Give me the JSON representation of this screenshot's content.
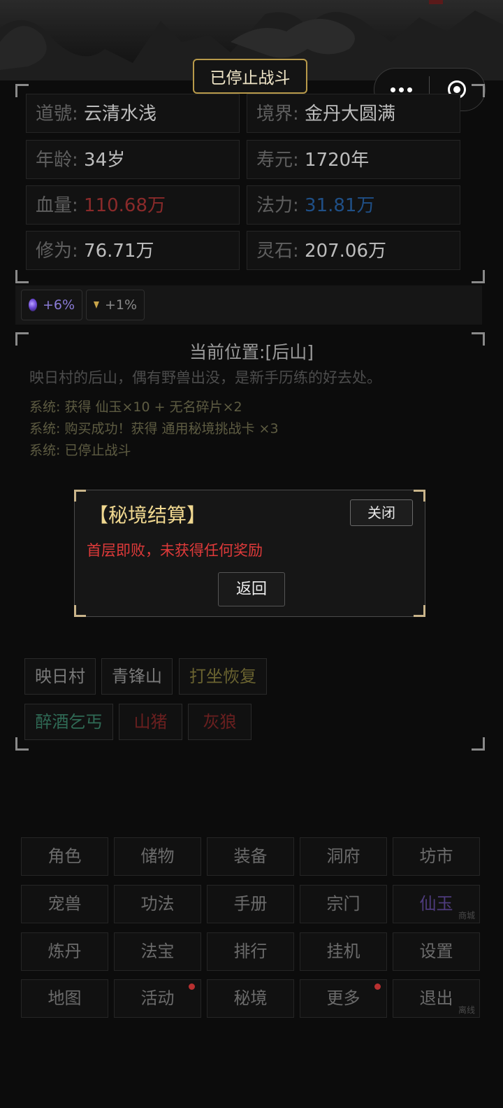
{
  "header": {
    "battle_status": "已停止战斗"
  },
  "stats": [
    {
      "label": "道號:",
      "value": "云清水浅"
    },
    {
      "label": "境界:",
      "value": "金丹大圆满"
    },
    {
      "label": "年龄:",
      "value": "34岁"
    },
    {
      "label": "寿元:",
      "value": "1720年"
    },
    {
      "label": "血量:",
      "value": "110.68万",
      "color": "#8a2a2a"
    },
    {
      "label": "法力:",
      "value": "31.81万",
      "color": "#1f4f86"
    },
    {
      "label": "修为:",
      "value": "76.71万"
    },
    {
      "label": "灵石:",
      "value": "207.06万"
    }
  ],
  "buffs": [
    {
      "icon": "purple-orb-icon",
      "text": "+6%",
      "color": "#8a7bd6"
    },
    {
      "icon": "gold-gem-icon",
      "text": "+1%",
      "color": "#8a8a8a"
    }
  ],
  "location": {
    "title": "当前位置:[后山]",
    "description": "映日村的后山，偶有野兽出没，是新手历练的好去处。"
  },
  "logs": [
    "系统: 获得 仙玉×10 + 无名碎片×2",
    "系统: 购买成功！获得 通用秘境挑战卡 ×3",
    "系统: 已停止战斗"
  ],
  "modal": {
    "title": "【秘境结算】",
    "close_label": "关闭",
    "message": "首层即败，未获得任何奖励",
    "back_label": "返回"
  },
  "destinations": [
    {
      "label": "映日村",
      "color": "#7a7a7a"
    },
    {
      "label": "青锋山",
      "color": "#7a7a7a"
    },
    {
      "label": "打坐恢复",
      "color": "#6a6330"
    }
  ],
  "npcs": [
    {
      "label": "醉酒乞丐",
      "color": "#2f6a55"
    },
    {
      "label": "山猪",
      "color": "#6a1f1f"
    },
    {
      "label": "灰狼",
      "color": "#6a1f1f"
    }
  ],
  "menu": [
    {
      "label": "角色"
    },
    {
      "label": "储物"
    },
    {
      "label": "装备"
    },
    {
      "label": "洞府"
    },
    {
      "label": "坊市"
    },
    {
      "label": "宠兽"
    },
    {
      "label": "功法"
    },
    {
      "label": "手册"
    },
    {
      "label": "宗门"
    },
    {
      "label": "仙玉",
      "sub": "商城",
      "color": "#4e3b7d"
    },
    {
      "label": "炼丹"
    },
    {
      "label": "法宝"
    },
    {
      "label": "排行"
    },
    {
      "label": "挂机"
    },
    {
      "label": "设置"
    },
    {
      "label": "地图"
    },
    {
      "label": "活动",
      "dot": true
    },
    {
      "label": "秘境"
    },
    {
      "label": "更多",
      "dot": true
    },
    {
      "label": "退出",
      "sub": "离线"
    }
  ]
}
